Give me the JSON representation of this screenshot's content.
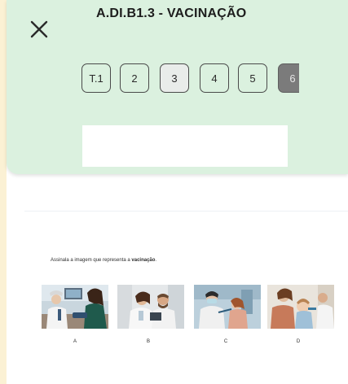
{
  "header": {
    "title": "A.DI.B1.3 - VACINAÇÃO",
    "close_icon": "close-icon"
  },
  "tabs": [
    {
      "label": "T.1",
      "state": "default"
    },
    {
      "label": "2",
      "state": "default"
    },
    {
      "label": "3",
      "state": "selected"
    },
    {
      "label": "4",
      "state": "default"
    },
    {
      "label": "5",
      "state": "default"
    },
    {
      "label": "6",
      "state": "active"
    }
  ],
  "question": {
    "prefix": "Assinala a imagem que representa a ",
    "keyword": "vacinação",
    "suffix": "."
  },
  "options": [
    {
      "label": "A",
      "image": "doctor-measuring-blood-pressure"
    },
    {
      "label": "B",
      "image": "two-doctors-with-tablet"
    },
    {
      "label": "C",
      "image": "child-receiving-vaccine"
    },
    {
      "label": "D",
      "image": "mother-and-child-doctor-visit"
    }
  ],
  "colors": {
    "page_bg": "#fbf1d4",
    "header_bg": "#dbf1df",
    "tab_selected_bg": "#e9ecea",
    "tab_active_bg": "#7b7b7b"
  }
}
